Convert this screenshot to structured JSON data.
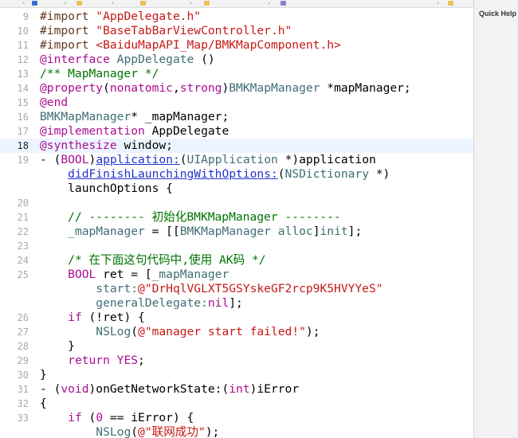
{
  "inspector": {
    "title": "Quick Help"
  },
  "lines": [
    {
      "num": "9",
      "segments": [
        {
          "t": "#import ",
          "c": "pp"
        },
        {
          "t": "\"AppDelegate.h\"",
          "c": "str"
        }
      ]
    },
    {
      "num": "10",
      "segments": [
        {
          "t": "#import ",
          "c": "pp"
        },
        {
          "t": "\"BaseTabBarViewController.h\"",
          "c": "str"
        }
      ]
    },
    {
      "num": "11",
      "segments": [
        {
          "t": "#import ",
          "c": "pp"
        },
        {
          "t": "<BaiduMapAPI_Map/BMKMapComponent.h>",
          "c": "str"
        }
      ]
    },
    {
      "num": "12",
      "segments": [
        {
          "t": "@interface",
          "c": "kw"
        },
        {
          "t": " "
        },
        {
          "t": "AppDelegate",
          "c": "cls"
        },
        {
          "t": " ()"
        }
      ]
    },
    {
      "num": "13",
      "segments": [
        {
          "t": "/** MapManager */",
          "c": "cm"
        }
      ]
    },
    {
      "num": "14",
      "segments": [
        {
          "t": "@property",
          "c": "kw"
        },
        {
          "t": "("
        },
        {
          "t": "nonatomic",
          "c": "kw"
        },
        {
          "t": ","
        },
        {
          "t": "strong",
          "c": "kw"
        },
        {
          "t": ")"
        },
        {
          "t": "BMKMapManager",
          "c": "cls"
        },
        {
          "t": " *mapManager;"
        }
      ]
    },
    {
      "num": "15",
      "segments": [
        {
          "t": "@end",
          "c": "kw"
        }
      ]
    },
    {
      "num": "16",
      "segments": [
        {
          "t": "BMKMapManager",
          "c": "cls"
        },
        {
          "t": "* _mapManager;"
        }
      ]
    },
    {
      "num": "17",
      "segments": [
        {
          "t": "@implementation",
          "c": "kw"
        },
        {
          "t": " AppDelegate"
        }
      ]
    },
    {
      "num": "18",
      "current": true,
      "segments": [
        {
          "t": "@synthesize",
          "c": "kw"
        },
        {
          "t": " window;"
        }
      ]
    },
    {
      "num": "19",
      "segments": [
        {
          "t": "- ("
        },
        {
          "t": "BOOL",
          "c": "kw"
        },
        {
          "t": ")"
        },
        {
          "t": "application:",
          "c": "lk"
        },
        {
          "t": "("
        },
        {
          "t": "UIApplication",
          "c": "cls"
        },
        {
          "t": " *)application"
        }
      ]
    },
    {
      "num": "",
      "segments": [
        {
          "t": "    "
        },
        {
          "t": "didFinishLaunchingWithOptions:",
          "c": "lk"
        },
        {
          "t": "("
        },
        {
          "t": "NSDictionary",
          "c": "cls"
        },
        {
          "t": " *)"
        }
      ]
    },
    {
      "num": "",
      "segments": [
        {
          "t": "    launchOptions {"
        }
      ]
    },
    {
      "num": "20",
      "segments": [
        {
          "t": ""
        }
      ]
    },
    {
      "num": "21",
      "segments": [
        {
          "t": "    "
        },
        {
          "t": "// -------- 初始化BMKMapManager --------",
          "c": "cm"
        }
      ]
    },
    {
      "num": "22",
      "segments": [
        {
          "t": "    "
        },
        {
          "t": "_mapManager",
          "c": "cls"
        },
        {
          "t": " = [["
        },
        {
          "t": "BMKMapManager",
          "c": "cls"
        },
        {
          "t": " "
        },
        {
          "t": "alloc",
          "c": "cls"
        },
        {
          "t": "]"
        },
        {
          "t": "init",
          "c": "cls"
        },
        {
          "t": "];"
        }
      ]
    },
    {
      "num": "23",
      "segments": [
        {
          "t": ""
        }
      ]
    },
    {
      "num": "24",
      "segments": [
        {
          "t": "    "
        },
        {
          "t": "/* 在下面这句代码中,使用 AK码 */",
          "c": "cm"
        }
      ]
    },
    {
      "num": "25",
      "segments": [
        {
          "t": "    "
        },
        {
          "t": "BOOL",
          "c": "kw"
        },
        {
          "t": " ret = ["
        },
        {
          "t": "_mapManager",
          "c": "cls"
        }
      ]
    },
    {
      "num": "",
      "segments": [
        {
          "t": "        "
        },
        {
          "t": "start:",
          "c": "cls"
        },
        {
          "t": "@\"DrHqlVGLXT5GSYskeGF2rcp9K5HVYYeS\"",
          "c": "str"
        }
      ]
    },
    {
      "num": "",
      "segments": [
        {
          "t": "        "
        },
        {
          "t": "generalDelegate:",
          "c": "cls"
        },
        {
          "t": "nil",
          "c": "kw"
        },
        {
          "t": "];"
        }
      ]
    },
    {
      "num": "26",
      "segments": [
        {
          "t": "    "
        },
        {
          "t": "if",
          "c": "kw"
        },
        {
          "t": " (!ret) {"
        }
      ]
    },
    {
      "num": "27",
      "segments": [
        {
          "t": "        "
        },
        {
          "t": "NSLog",
          "c": "cls"
        },
        {
          "t": "("
        },
        {
          "t": "@\"manager start failed!\"",
          "c": "str"
        },
        {
          "t": ");"
        }
      ]
    },
    {
      "num": "28",
      "segments": [
        {
          "t": "    }"
        }
      ]
    },
    {
      "num": "29",
      "segments": [
        {
          "t": "    "
        },
        {
          "t": "return",
          "c": "kw"
        },
        {
          "t": " "
        },
        {
          "t": "YES",
          "c": "kw"
        },
        {
          "t": ";"
        }
      ]
    },
    {
      "num": "30",
      "segments": [
        {
          "t": "}"
        }
      ]
    },
    {
      "num": "31",
      "segments": [
        {
          "t": "- ("
        },
        {
          "t": "void",
          "c": "kw"
        },
        {
          "t": ")onGetNetworkState:("
        },
        {
          "t": "int",
          "c": "kw"
        },
        {
          "t": ")iError"
        }
      ]
    },
    {
      "num": "32",
      "segments": [
        {
          "t": "{"
        }
      ]
    },
    {
      "num": "33",
      "segments": [
        {
          "t": "    "
        },
        {
          "t": "if",
          "c": "kw"
        },
        {
          "t": " ("
        },
        {
          "t": "0",
          "c": "kw"
        },
        {
          "t": " == iError) {"
        }
      ]
    },
    {
      "num": "",
      "segments": [
        {
          "t": "        "
        },
        {
          "t": "NSLog",
          "c": "cls"
        },
        {
          "t": "("
        },
        {
          "t": "@\"联网成功\"",
          "c": "str"
        },
        {
          "t": ");"
        }
      ]
    }
  ]
}
